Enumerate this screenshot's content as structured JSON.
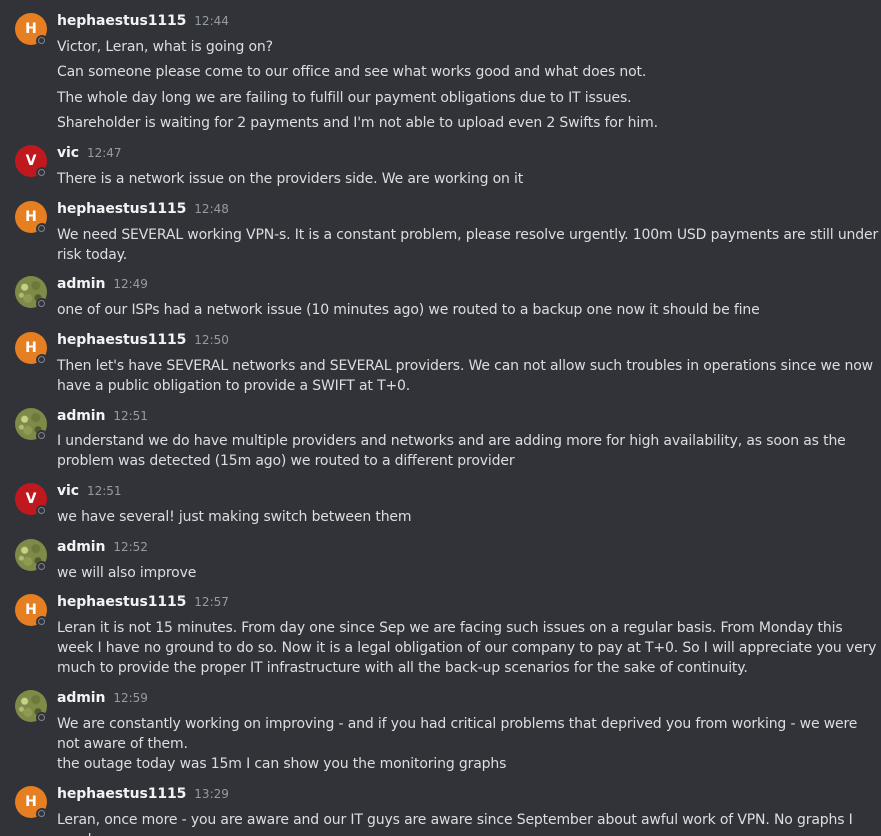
{
  "messages": [
    {
      "author": "hephaestus1115",
      "avatar_letter": "H",
      "avatar_color": "#e67e22",
      "time": "12:44",
      "lines": [
        "Victor, Leran, what is going on?",
        "Can someone please come to our office and see what works good and what does not.",
        "The whole day long we are failing to fulfill our payment obligations due to IT issues.",
        "Shareholder is waiting for 2 payments and I'm not able to upload even 2 Swifts for him."
      ]
    },
    {
      "author": "vic",
      "avatar_letter": "V",
      "avatar_color": "#c0181f",
      "time": "12:47",
      "lines": [
        "There is a network issue on the providers side. We are working on it"
      ]
    },
    {
      "author": "hephaestus1115",
      "avatar_letter": "H",
      "avatar_color": "#e67e22",
      "time": "12:48",
      "lines": [
        "We need SEVERAL working VPN-s. It is a constant problem, please resolve urgently. 100m USD payments are still under risk today."
      ]
    },
    {
      "author": "admin",
      "avatar_letter": "",
      "avatar_color": "#7d8a48",
      "time": "12:49",
      "lines": [
        "one of our ISPs had a network issue (10 minutes ago) we routed to a backup one now it should be fine"
      ]
    },
    {
      "author": "hephaestus1115",
      "avatar_letter": "H",
      "avatar_color": "#e67e22",
      "time": "12:50",
      "lines": [
        "Then let's have SEVERAL networks and SEVERAL providers. We can not allow such troubles in operations since we now have a public obligation to provide a SWIFT at T+0."
      ]
    },
    {
      "author": "admin",
      "avatar_letter": "",
      "avatar_color": "#7d8a48",
      "time": "12:51",
      "lines": [
        "I understand we do have multiple providers and networks and are adding more for high availability, as soon as the problem was detected (15m ago) we routed to a different provider"
      ]
    },
    {
      "author": "vic",
      "avatar_letter": "V",
      "avatar_color": "#c0181f",
      "time": "12:51",
      "lines": [
        "we have several! just making switch between them"
      ]
    },
    {
      "author": "admin",
      "avatar_letter": "",
      "avatar_color": "#7d8a48",
      "time": "12:52",
      "lines": [
        "we will also improve"
      ]
    },
    {
      "author": "hephaestus1115",
      "avatar_letter": "H",
      "avatar_color": "#e67e22",
      "time": "12:57",
      "lines": [
        "Leran it is not 15 minutes. From day one since Sep we are facing such issues on a regular basis. From Monday this week I have no ground to do so. Now it is a legal obligation of our company to pay at T+0. So I will appreciate you very much to provide the proper IT infrastructure with all the back-up scenarios for the sake of continuity."
      ]
    },
    {
      "author": "admin",
      "avatar_letter": "",
      "avatar_color": "#7d8a48",
      "time": "12:59",
      "lines": [
        "We are constantly working on improving - and if you had critical problems that deprived you from working - we were not aware of them.",
        "the outage today was 15m I can show you the monitoring graphs"
      ]
    },
    {
      "author": "hephaestus1115",
      "avatar_letter": "H",
      "avatar_color": "#e67e22",
      "time": "13:29",
      "lines": [
        "Leran, once more - you are aware and our IT guys are aware since September about awful work of VPN. No graphs I need, no"
      ]
    }
  ]
}
